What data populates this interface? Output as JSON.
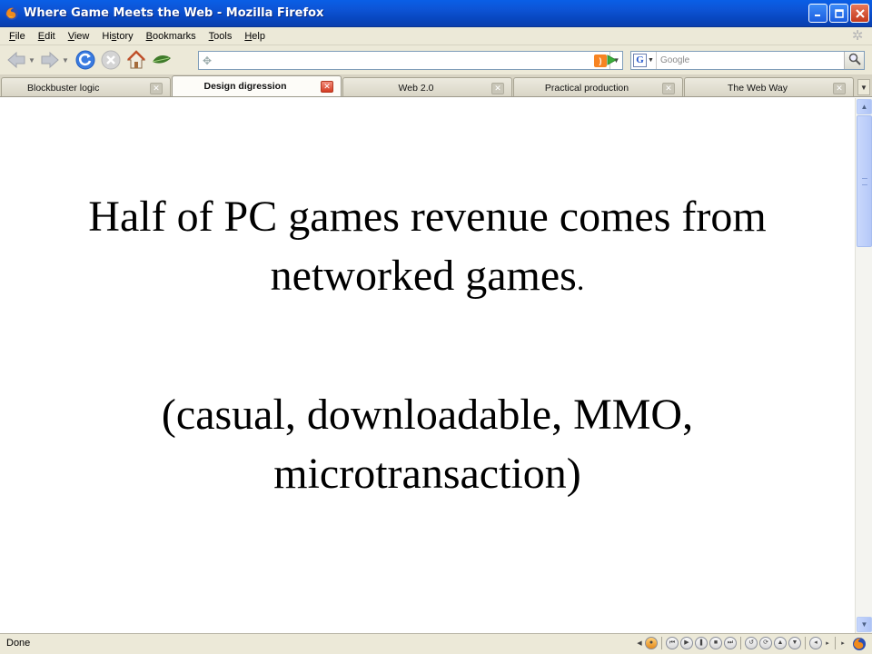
{
  "window": {
    "title": "Where Game Meets the Web - Mozilla Firefox"
  },
  "menubar": {
    "items": [
      {
        "accel": "F",
        "rest": "ile"
      },
      {
        "accel": "E",
        "rest": "dit"
      },
      {
        "accel": "V",
        "rest": "iew"
      },
      {
        "prefix": "Hi",
        "accel": "s",
        "rest": "tory"
      },
      {
        "accel": "B",
        "rest": "ookmarks"
      },
      {
        "accel": "T",
        "rest": "ools"
      },
      {
        "accel": "H",
        "rest": "elp"
      }
    ]
  },
  "navbar": {
    "url": "",
    "search_placeholder": "Google",
    "search_engine_letter": "G",
    "rss_letter": ")"
  },
  "tabs": [
    {
      "label": "Blockbuster logic",
      "active": false
    },
    {
      "label": "Design digression",
      "active": true
    },
    {
      "label": "Web 2.0",
      "active": false
    },
    {
      "label": "Practical production",
      "active": false
    },
    {
      "label": "The Web Way",
      "active": false
    }
  ],
  "content": {
    "line1": "Half of PC games revenue comes from",
    "line2_main": "networked games",
    "line2_end": ".",
    "line3": "(casual, downloadable, MMO,",
    "line4": "microtransaction)"
  },
  "statusbar": {
    "text": "Done"
  },
  "icons": {
    "app": "firefox-icon",
    "back": "back-arrow-icon",
    "forward": "forward-arrow-icon",
    "reload": "reload-icon",
    "stop": "stop-icon",
    "home": "home-icon",
    "leaf": "leaf-icon",
    "go": "go-arrow-icon",
    "search": "magnifier-icon"
  },
  "colors": {
    "titlebar": "#0d54d6",
    "chrome": "#ece9d8",
    "active_tab_close": "#d43c22"
  }
}
